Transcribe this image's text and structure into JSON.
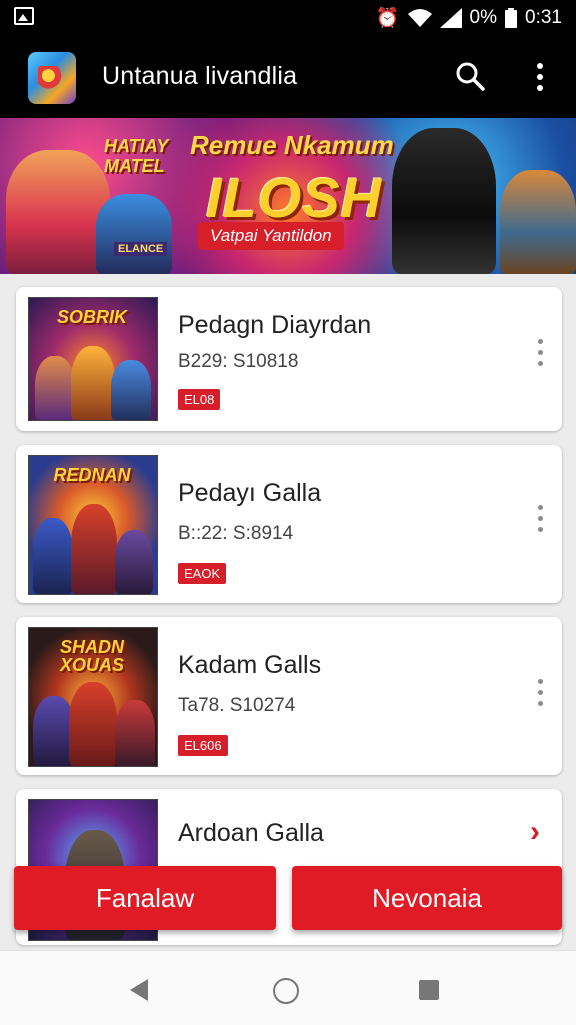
{
  "status_bar": {
    "battery": "0%",
    "time": "0:31"
  },
  "app_bar": {
    "title": "Untanua livandlia"
  },
  "banner": {
    "headline_top": "Remue Nkamum",
    "headline_left": "HATIAY MATEL",
    "headline_big": "ILOSH",
    "subtitle": "Vatpai Yantildon",
    "badge": "ELANCE"
  },
  "items": [
    {
      "title": "Pedagn Diayrdan",
      "meta": "B229: S10818",
      "tag": "EL08",
      "thumb_title": "SOBRIK"
    },
    {
      "title": "Pedayı Galla",
      "meta": "B::22: S:8914",
      "tag": "EAOK",
      "thumb_title": "REDNAN"
    },
    {
      "title": "Kadam Galls",
      "meta": "Ta78. S10274",
      "tag": "EL606",
      "thumb_title": "SHADN XOUAS"
    },
    {
      "title": "Ardoan Galla",
      "meta": "",
      "tag": "",
      "thumb_title": ""
    }
  ],
  "buttons": {
    "left": "Fanalaw",
    "right": "Nevonaia"
  },
  "colors": {
    "accent": "#e01b25",
    "bar": "#000000"
  }
}
